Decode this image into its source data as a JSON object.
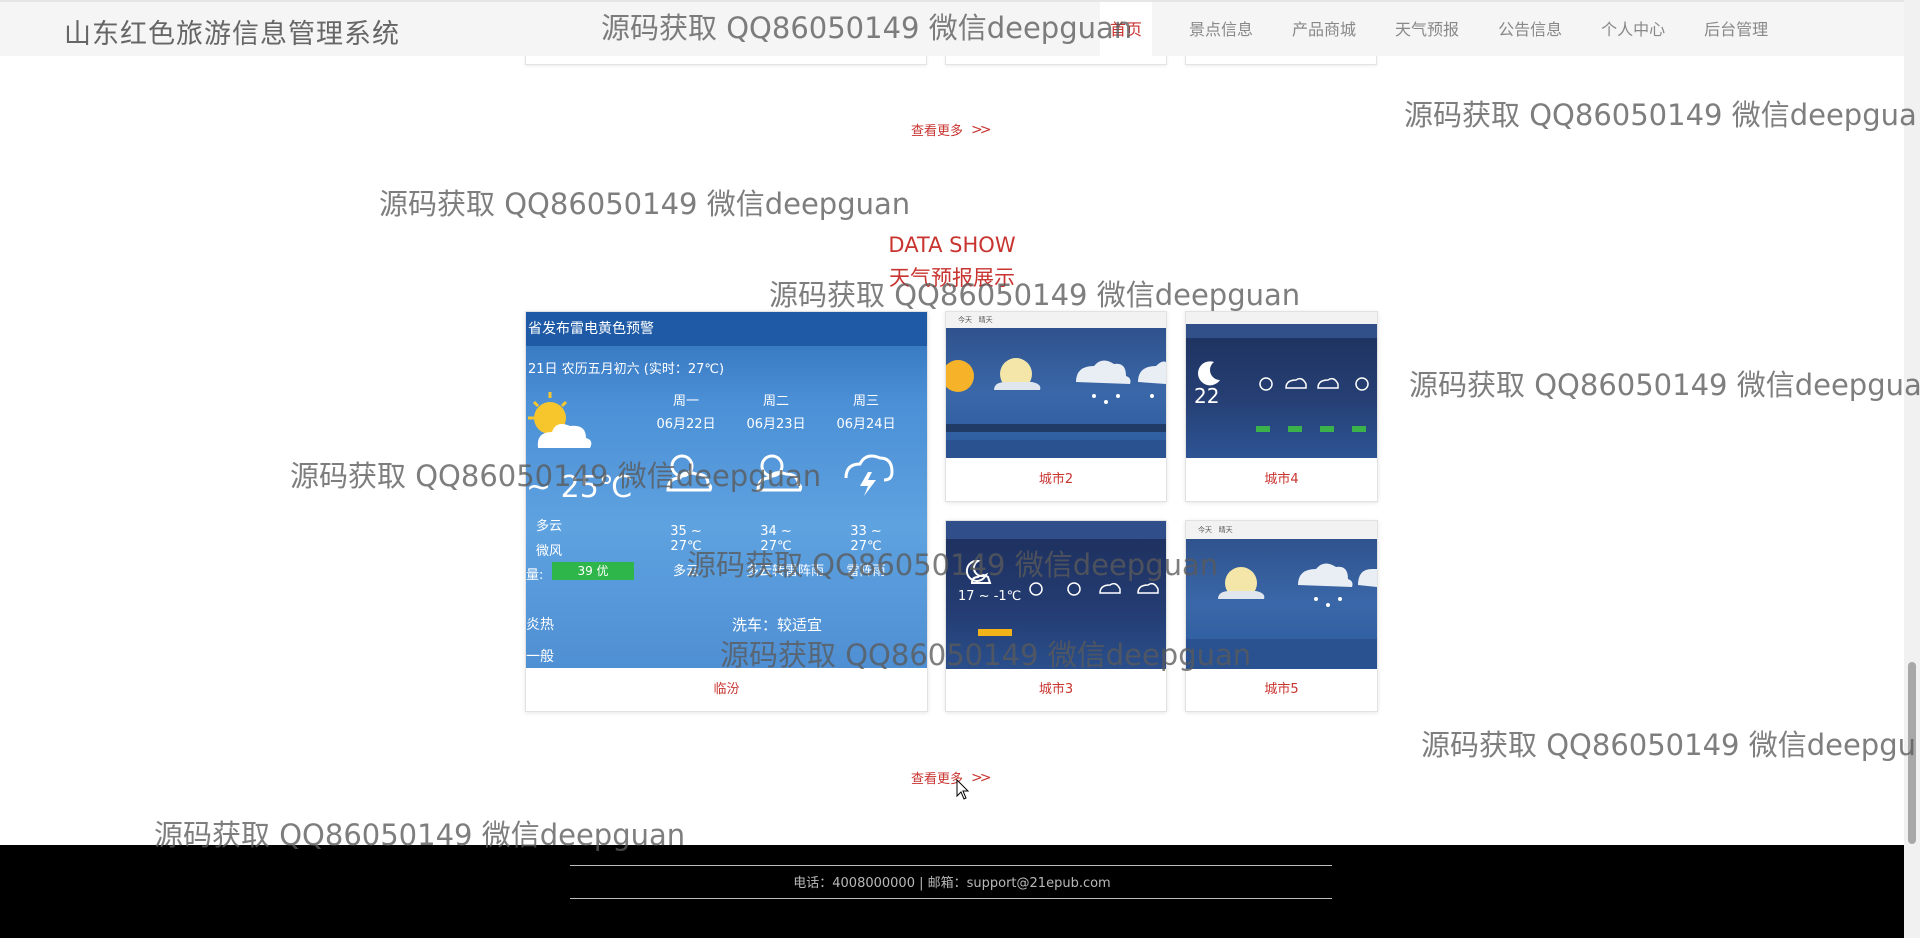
{
  "header": {
    "site_title": "山东红色旅游信息管理系统",
    "nav": [
      {
        "label": "首页",
        "active": true
      },
      {
        "label": "景点信息"
      },
      {
        "label": "产品商城"
      },
      {
        "label": "天气预报"
      },
      {
        "label": "公告信息"
      },
      {
        "label": "个人中心"
      },
      {
        "label": "后台管理"
      }
    ]
  },
  "more_label_top": "查看更多",
  "section": {
    "title_en": "DATA SHOW",
    "title_cn": "天气预报展示",
    "more_label": "查看更多"
  },
  "cards": [
    {
      "label": "临汾"
    },
    {
      "label": "城市2"
    },
    {
      "label": "城市4"
    },
    {
      "label": "城市3"
    },
    {
      "label": "城市5"
    }
  ],
  "big_thumb": {
    "banner": "省发布雷电黄色预警",
    "date_line": "21日 农历五月初六 (实时：27℃)",
    "today_temp": "~ 25℃",
    "today_desc": "多云",
    "today_wind": "微风",
    "aqi_label": "量:",
    "aqi_value": "39 优",
    "days": [
      {
        "day": "周一",
        "date": "06月22日",
        "temp": "35 ~ 27℃",
        "desc": "多云"
      },
      {
        "day": "周二",
        "date": "06月23日",
        "temp": "34 ~ 27℃",
        "desc": "多云转雷阵雨"
      },
      {
        "day": "周三",
        "date": "06月24日",
        "temp": "33 ~ 27℃",
        "desc": "雷阵雨"
      }
    ],
    "hot": "炎热",
    "normal": "一般",
    "carwash": "洗车：较适宜"
  },
  "small_thumb_texts": {
    "c4_temp": "22",
    "c3_temp": "17 ~ -1℃"
  },
  "footer": {
    "text": "电话：4008000000 | 邮箱：support@21epub.com"
  },
  "watermark": "源码获取 QQ86050149 微信deepguan",
  "watermark_cut": "源码获取 QQ86050149 微信deepgua",
  "watermark_cut2": "源码获取 QQ86050149 微信deepgu"
}
